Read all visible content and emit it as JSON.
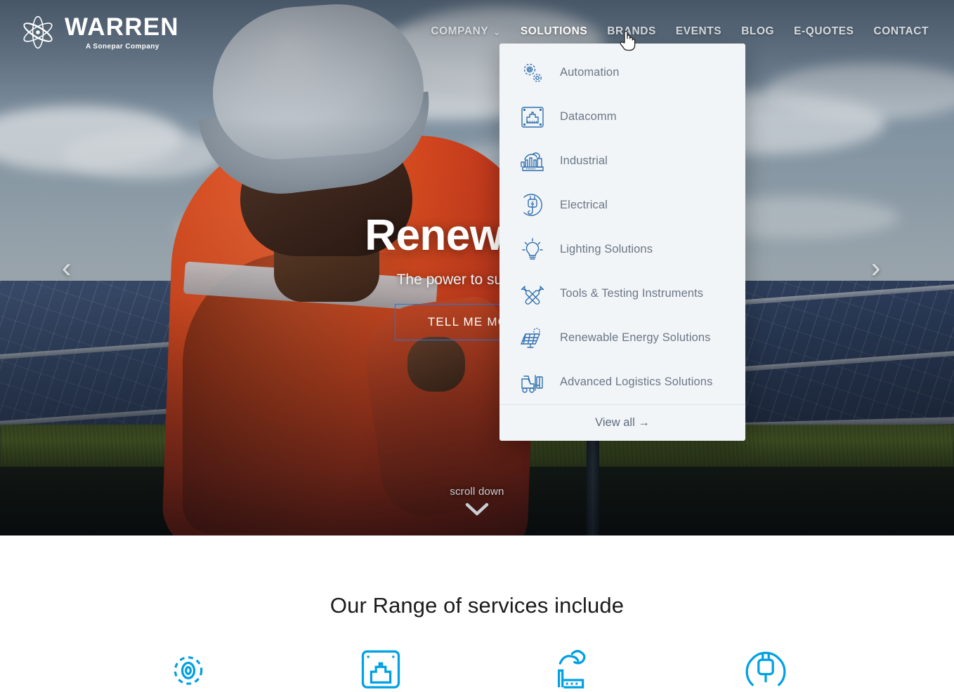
{
  "brand": {
    "name": "WARREN",
    "tagline": "A Sonepar Company",
    "logo_icon": "atom-flower-logo-icon",
    "accent_blue": "#00a0e3",
    "dropdown_icon_blue": "#2f6fad"
  },
  "nav": {
    "items": [
      {
        "label": "COMPANY",
        "has_chevron": true,
        "chevron": "⌄",
        "active": false
      },
      {
        "label": "SOLUTIONS",
        "has_chevron": false,
        "chevron": "",
        "active": true
      },
      {
        "label": "BRANDS",
        "has_chevron": false,
        "chevron": "",
        "active": false
      },
      {
        "label": "EVENTS",
        "has_chevron": false,
        "chevron": "",
        "active": false
      },
      {
        "label": "BLOG",
        "has_chevron": false,
        "chevron": "",
        "active": false
      },
      {
        "label": "E-QUOTES",
        "has_chevron": false,
        "chevron": "",
        "active": false
      },
      {
        "label": "CONTACT",
        "has_chevron": false,
        "chevron": "",
        "active": false
      }
    ]
  },
  "dropdown": {
    "open_for": "SOLUTIONS",
    "items": [
      {
        "label": "Automation",
        "icon": "gears-automation-icon"
      },
      {
        "label": "Datacomm",
        "icon": "ethernet-port-icon"
      },
      {
        "label": "Industrial",
        "icon": "factory-icon"
      },
      {
        "label": "Electrical",
        "icon": "power-plug-icon"
      },
      {
        "label": "Lighting Solutions",
        "icon": "lightbulb-icon"
      },
      {
        "label": "Tools & Testing Instruments",
        "icon": "wrench-screwdriver-icon"
      },
      {
        "label": "Renewable Energy Solutions",
        "icon": "solar-panel-sun-icon"
      },
      {
        "label": "Advanced Logistics Solutions",
        "icon": "forklift-icon"
      }
    ],
    "footer_label": "View all →"
  },
  "hero": {
    "title": "Renewable",
    "subtitle": "The power to succeed in",
    "button_label": "TELL ME MORE",
    "prev_arrow": "‹",
    "next_arrow": "›",
    "scroll_label": "scroll down",
    "scroll_icon": "chevron-down-icon"
  },
  "services": {
    "heading": "Our Range of services include",
    "items": [
      {
        "icon": "gear-automation-service-icon"
      },
      {
        "icon": "datacomm-service-icon"
      },
      {
        "icon": "industrial-service-icon"
      },
      {
        "icon": "electrical-service-icon"
      }
    ]
  },
  "cursor": {
    "icon": "pointing-hand-cursor"
  }
}
